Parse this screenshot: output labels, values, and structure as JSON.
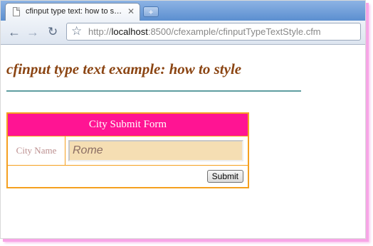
{
  "browser": {
    "tab_title": "cfinput type text: how to s…",
    "tab_close": "✕",
    "new_tab": "+",
    "url_prefix": "http://",
    "url_host": "localhost",
    "url_rest": ":8500/cfexample/cfinputTypeTextStyle.cfm",
    "icons": {
      "back": "back-arrow-icon",
      "forward": "forward-arrow-icon",
      "reload": "reload-icon",
      "bookmark": "star-icon"
    }
  },
  "page": {
    "heading": "cfinput type text example: how to style",
    "form": {
      "header": "City Submit Form",
      "city_label": "City Name",
      "city_value": "Rome",
      "submit_label": "Submit"
    }
  },
  "colors": {
    "heading": "#8b4513",
    "rule": "#5f9ea0",
    "form_border": "#f5a01f",
    "form_header_bg": "#ff1493",
    "label_text": "#bc8f8f",
    "input_bg": "#f5deb3",
    "frame_shadow": "#f7a6e6"
  }
}
